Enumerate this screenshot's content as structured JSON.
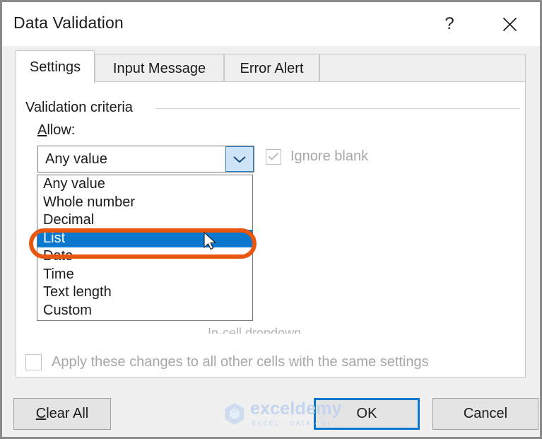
{
  "window": {
    "title": "Data Validation",
    "help_icon": "question-mark-icon",
    "close_icon": "close-x-icon"
  },
  "tabs": [
    {
      "label": "Settings",
      "active": true
    },
    {
      "label": "Input Message",
      "active": false
    },
    {
      "label": "Error Alert",
      "active": false
    }
  ],
  "settings": {
    "group_label": "Validation criteria",
    "allow_label_prefix": "A",
    "allow_label_rest": "llow:",
    "combo": {
      "value": "Any value",
      "arrow_icon": "chevron-down-icon"
    },
    "ignore_blank": {
      "label": "Ignore blank",
      "checked": true,
      "disabled": true,
      "check_icon": "checkmark-icon"
    },
    "obscured_artifact": "In-cell dropdown",
    "apply_all": {
      "label": "Apply these changes to all other cells with the same settings",
      "checked": false,
      "disabled": true
    }
  },
  "dropdown": {
    "options": [
      "Any value",
      "Whole number",
      "Decimal",
      "List",
      "Date",
      "Time",
      "Text length",
      "Custom"
    ],
    "selected": "List",
    "selected_index": 3
  },
  "annotation": {
    "shape": "rounded-rectangle-highlight",
    "color": "#E8560F",
    "target": "List"
  },
  "cursor": {
    "icon": "mouse-pointer-arrow"
  },
  "footer": {
    "clear_all_prefix": "C",
    "clear_all_rest": "lear All",
    "ok_label": "OK",
    "cancel_label": "Cancel"
  },
  "watermark": {
    "name": "exceldemy",
    "tagline": "EXCEL · DATA · BI",
    "logo_icon": "hexagon-cube-logo-icon",
    "color": "#C3D4EE"
  },
  "colors": {
    "selection_blue": "#0B78D0",
    "focus_blue": "#0B78D0",
    "annotation_orange": "#E8560F",
    "dialog_bg": "#F0F0F0",
    "panel_bg": "#FFFFFF"
  }
}
